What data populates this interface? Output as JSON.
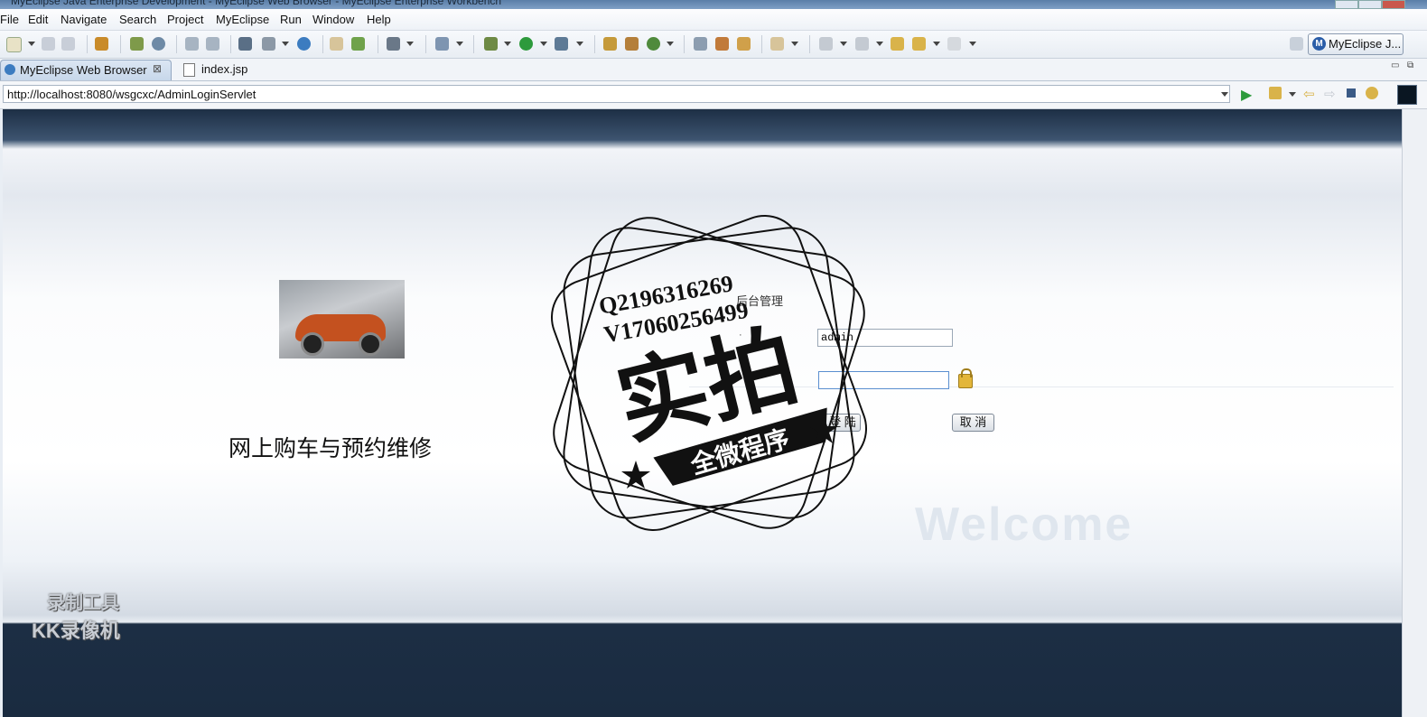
{
  "window": {
    "title": "MyEclipse Java Enterprise Development - MyEclipse Web Browser - MyEclipse Enterprise Workbench"
  },
  "menu": [
    "File",
    "Edit",
    "Navigate",
    "Search",
    "Project",
    "MyEclipse",
    "Run",
    "Window",
    "Help"
  ],
  "perspective": {
    "label": "MyEclipse J..."
  },
  "tabs": [
    {
      "label": "MyEclipse Web Browser",
      "active": true
    },
    {
      "label": "index.jsp",
      "active": false
    }
  ],
  "browser": {
    "url": "http://localhost:8080/wsgcxc/AdminLoginServlet"
  },
  "page": {
    "site_title": "网上购车与预约维修",
    "admin_label": "后台管理",
    "username_value": "admin",
    "password_value": "",
    "login_button": "登 陆",
    "cancel_button": "取 消",
    "welcome_text": "Welcome"
  },
  "watermark": {
    "qq": "Q2196316269",
    "wechat": "V17060256499",
    "big_text": "实拍",
    "banner_text": "全微程序"
  },
  "recorder": {
    "line1": "录制工具",
    "line2": "KK录像机"
  }
}
